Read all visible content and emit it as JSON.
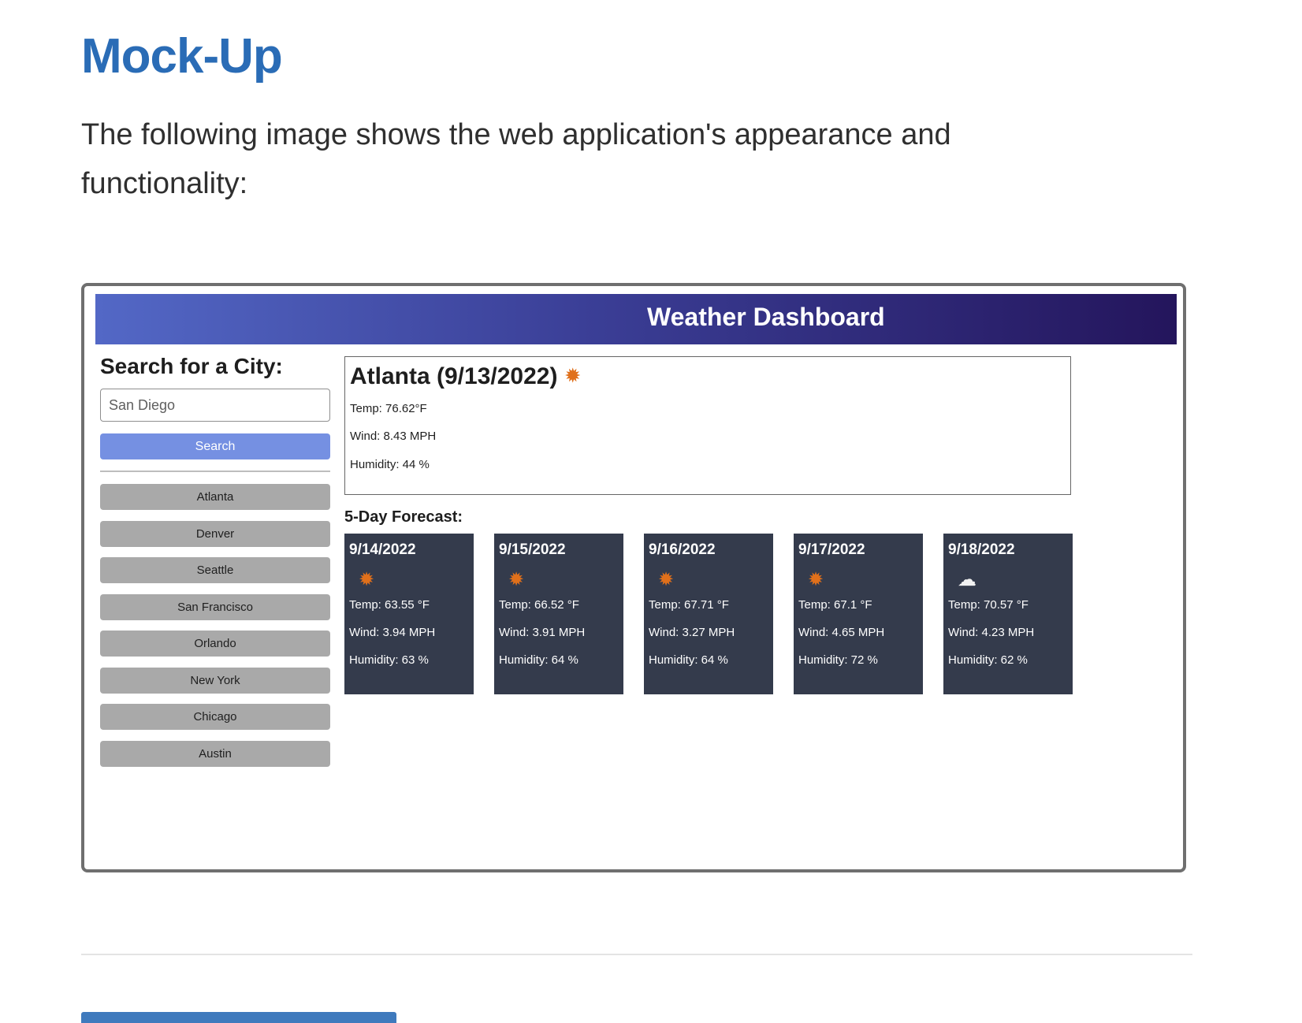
{
  "doc": {
    "title": "Mock-Up",
    "paragraph": "The following image shows the web application's appearance and functionality:"
  },
  "app": {
    "title": "Weather Dashboard",
    "search": {
      "heading": "Search for a City:",
      "placeholder": "San Diego",
      "button_label": "Search"
    },
    "history": [
      "Atlanta",
      "Denver",
      "Seattle",
      "San Francisco",
      "Orlando",
      "New York",
      "Chicago",
      "Austin"
    ],
    "current": {
      "city_date": "Atlanta (9/13/2022)",
      "icon": "sun-icon",
      "temp": "Temp: 76.62°F",
      "wind": "Wind: 8.43 MPH",
      "humidity": "Humidity: 44 %"
    },
    "forecast": {
      "title": "5-Day Forecast:",
      "days": [
        {
          "date": "9/14/2022",
          "icon": "sun-icon",
          "temp": "Temp: 63.55 °F",
          "wind": "Wind: 3.94 MPH",
          "humidity": "Humidity: 63 %"
        },
        {
          "date": "9/15/2022",
          "icon": "sun-icon",
          "temp": "Temp: 66.52 °F",
          "wind": "Wind: 3.91 MPH",
          "humidity": "Humidity: 64 %"
        },
        {
          "date": "9/16/2022",
          "icon": "sun-icon",
          "temp": "Temp: 67.71 °F",
          "wind": "Wind: 3.27 MPH",
          "humidity": "Humidity: 64 %"
        },
        {
          "date": "9/17/2022",
          "icon": "sun-icon",
          "temp": "Temp: 67.1 °F",
          "wind": "Wind: 4.65 MPH",
          "humidity": "Humidity: 72 %"
        },
        {
          "date": "9/18/2022",
          "icon": "cloud-icon",
          "temp": "Temp: 70.57 °F",
          "wind": "Wind: 4.23 MPH",
          "humidity": "Humidity: 62 %"
        }
      ]
    }
  },
  "colors": {
    "doc_heading": "#2a6cb6",
    "header_gradient_start": "#5368c6",
    "header_gradient_end": "#24155c",
    "search_button": "#7590e2",
    "history_button": "#a9a9a9",
    "forecast_card": "#343b4c",
    "sun": "#e0701b"
  }
}
